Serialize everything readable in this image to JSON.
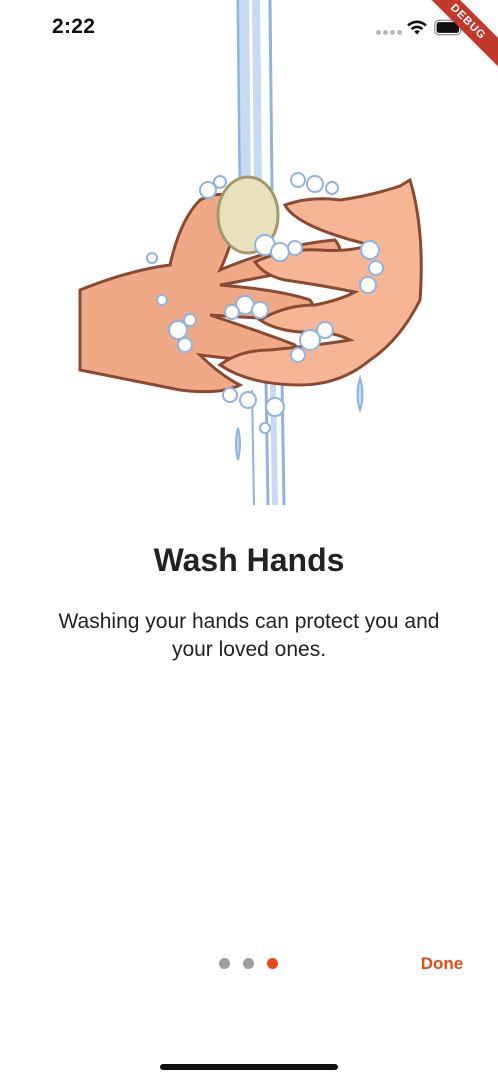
{
  "status_bar": {
    "time": "2:22",
    "debug_label": "DEBUG"
  },
  "onboarding": {
    "title": "Wash Hands",
    "description": "Washing your hands can protect you and your loved ones.",
    "pages_total": 3,
    "current_page": 3,
    "done_label": "Done"
  },
  "icons": {
    "wifi": "wifi-icon",
    "battery": "battery-icon",
    "illustration": "hand-washing-illustration"
  },
  "colors": {
    "accent": "#e64a19",
    "dot_inactive": "#9e9e9e",
    "text": "#222222",
    "debug_banner": "#c0392b"
  }
}
